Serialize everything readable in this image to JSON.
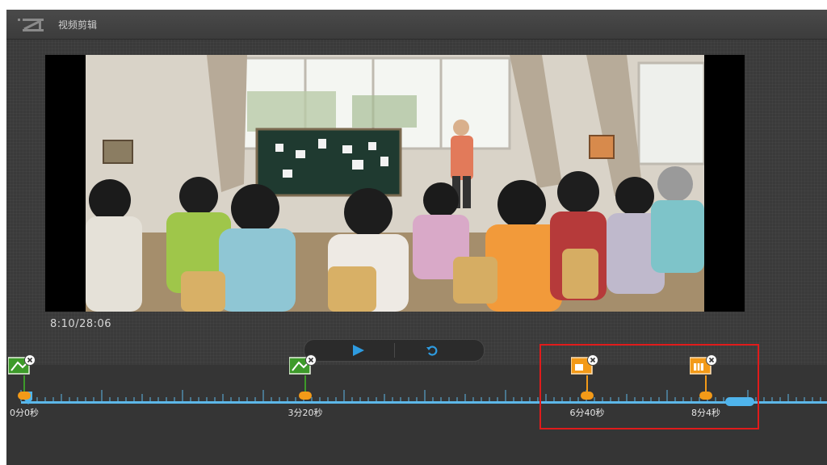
{
  "app": {
    "title": "视频剪辑"
  },
  "player": {
    "time_readout": "8:10/28:06",
    "play_icon": "play-icon",
    "replay_icon": "replay-icon"
  },
  "timeline": {
    "markers": [
      {
        "label": "0分0秒",
        "type": "green-scene-marker"
      },
      {
        "label": "3分20秒",
        "type": "green-scene-marker"
      },
      {
        "label": "6分40秒",
        "type": "orange-edit-marker"
      },
      {
        "label": "8分4秒",
        "type": "orange-edit-marker"
      }
    ]
  },
  "colors": {
    "accent_blue": "#5db7e8",
    "marker_orange": "#f39a18",
    "marker_green": "#3d9a2a",
    "highlight_red": "#e01b1b"
  }
}
